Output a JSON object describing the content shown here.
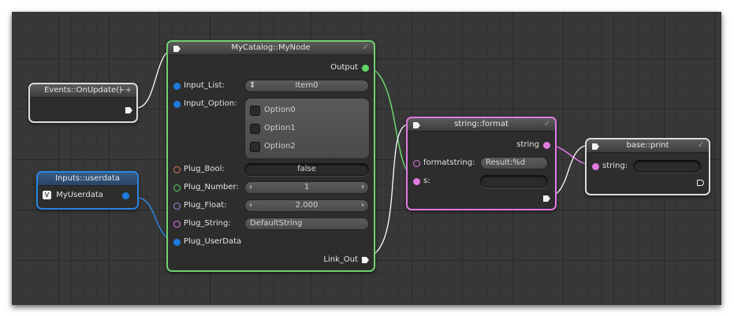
{
  "nodes": {
    "events": {
      "title": "Events::OnUpdate()",
      "controls": "−+"
    },
    "userdata": {
      "title": "Inputs::userdata",
      "badge": "V",
      "output_label": "MyUserdata"
    },
    "mynode": {
      "title": "MyCatalog::MyNode",
      "check": "✓",
      "output_label": "Output",
      "input_list_label": "Input_List:",
      "input_list_value": "Item0",
      "input_option_label": "Input_Option:",
      "options": [
        "Option0",
        "Option1",
        "Option2"
      ],
      "plug_bool_label": "Plug_Bool:",
      "plug_bool_value": "false",
      "plug_number_label": "Plug_Number:",
      "plug_number_value": "1",
      "plug_float_label": "Plug_Float:",
      "plug_float_value": "2.000",
      "plug_string_label": "Plug_String:",
      "plug_string_value": "DefaultString",
      "plug_userdata_label": "Plug_UserData",
      "link_out_label": "Link_Out"
    },
    "format": {
      "title": "string::format",
      "check": "✓",
      "output_label": "string",
      "formatstring_label": "formatstring:",
      "formatstring_value": "Result:%d",
      "s_label": "s:"
    },
    "print": {
      "title": "base::print",
      "check": "✓",
      "string_label": "string:"
    }
  },
  "colors": {
    "mynode_border": "#6fd36f",
    "format_border": "#e37ae3",
    "userdata_border": "#2a86e0",
    "pin_blue": "#1d7be0",
    "pin_orange": "#d97a55",
    "pin_green": "#62d362",
    "pin_purple": "#9a8ce0",
    "pin_pink": "#e07ae0"
  }
}
